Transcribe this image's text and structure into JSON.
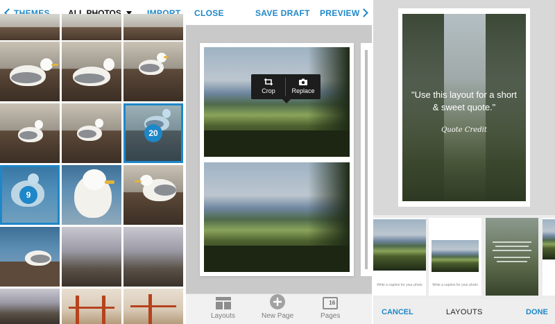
{
  "left_panel": {
    "back_label": "THEMES",
    "source_label": "ALL PHOTOS",
    "import_label": "IMPORT",
    "selected_badges": [
      "20",
      "9"
    ]
  },
  "middle_panel": {
    "close_label": "CLOSE",
    "save_label": "SAVE DRAFT",
    "preview_label": "PREVIEW",
    "tooltip": {
      "crop_label": "Crop",
      "replace_label": "Replace"
    },
    "bottom_bar": {
      "layouts_label": "Layouts",
      "new_page_label": "New Page",
      "pages_label": "Pages",
      "pages_count": "16"
    }
  },
  "right_panel": {
    "quote_text": "\"Use this layout for a short & sweet quote.\"",
    "quote_credit": "Quote Credit",
    "thumb_captions": [
      "Write a caption for your photo",
      "Write a caption for your photo"
    ],
    "cancel_label": "CANCEL",
    "title_label": "LAYOUTS",
    "done_label": "DONE"
  },
  "colors": {
    "accent": "#1e87c8",
    "tooltip_bg": "#1d1d1d"
  },
  "icons": [
    "chevron-left-icon",
    "caret-down-icon",
    "chevron-right-icon",
    "crop-icon",
    "camera-icon",
    "layouts-icon",
    "plus-circle-icon",
    "pages-icon"
  ]
}
